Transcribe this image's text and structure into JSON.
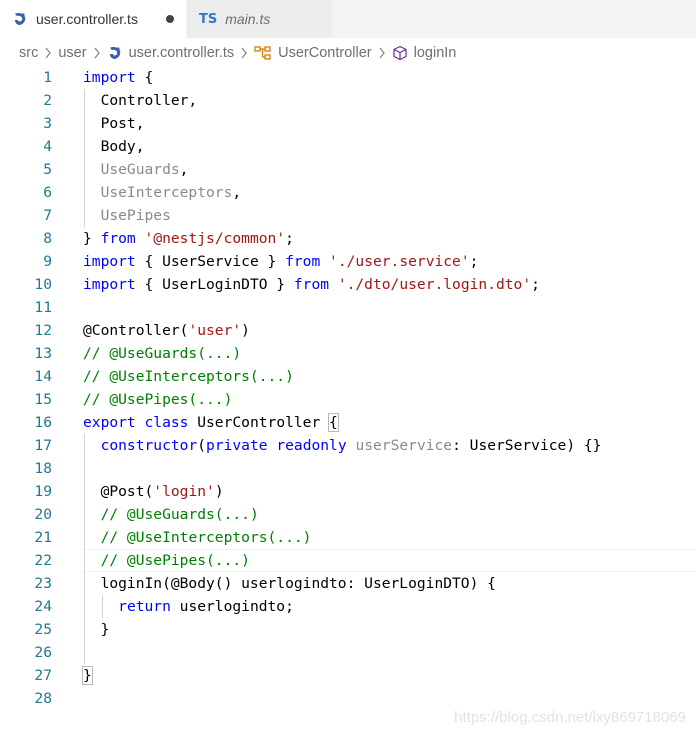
{
  "tabs": [
    {
      "label": "user.controller.ts",
      "icon": "nestjs-icon",
      "active": true,
      "modified": true
    },
    {
      "label": "main.ts",
      "icon": "typescript-icon",
      "icon_text": "TS",
      "active": false
    }
  ],
  "breadcrumb": {
    "items": [
      "src",
      "user",
      "user.controller.ts",
      "UserController",
      "loginIn"
    ]
  },
  "editor": {
    "line_numbers": [
      "1",
      "2",
      "3",
      "4",
      "5",
      "6",
      "7",
      "8",
      "9",
      "10",
      "11",
      "12",
      "13",
      "14",
      "15",
      "16",
      "17",
      "18",
      "19",
      "20",
      "21",
      "22",
      "23",
      "24",
      "25",
      "26",
      "27",
      "28"
    ],
    "current_line": 22
  },
  "watermark": "https://blog.csdn.net/lxy869718069",
  "colors": {
    "keyword": "#0000ff",
    "string": "#a31515",
    "comment": "#008000",
    "line_number": "#237893",
    "unused": "#8a8a8a"
  }
}
